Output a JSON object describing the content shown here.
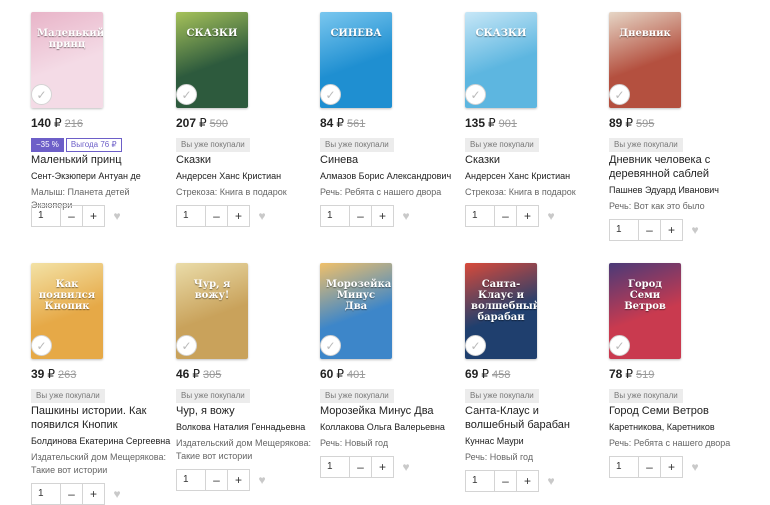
{
  "currency": "₽",
  "qty_default": "1",
  "books": [
    {
      "title": "Маленький принц",
      "author": "Сент-Экзюпери Антуан де",
      "series": "Малыш: Планета детей Экзюпери",
      "price": "140",
      "old_price": "216",
      "discount": "−35 %",
      "saving": "Выгода 76 ₽",
      "bought": "",
      "cover_text": "Маленький принц",
      "cover_bg": "#f4dbe6",
      "cover_accent": "#e8b4c8"
    },
    {
      "title": "Сказки",
      "author": "Андерсен Ханс Кристиан",
      "series": "Стрекоза: Книга в подарок",
      "price": "207",
      "old_price": "590",
      "discount": "",
      "saving": "",
      "bought": "Вы уже покупали",
      "cover_text": "СКАЗКИ",
      "cover_bg": "#2d5a3d",
      "cover_accent": "#a6c25a"
    },
    {
      "title": "Синева",
      "author": "Алмазов Борис Александрович",
      "series": "Речь: Ребята с нашего двора",
      "price": "84",
      "old_price": "561",
      "discount": "",
      "saving": "",
      "bought": "Вы уже покупали",
      "cover_text": "СИНЕВА",
      "cover_bg": "#1f8fd1",
      "cover_accent": "#7ac7ef"
    },
    {
      "title": "Сказки",
      "author": "Андерсен Ханс Кристиан",
      "series": "Стрекоза: Книга в подарок",
      "price": "135",
      "old_price": "901",
      "discount": "",
      "saving": "",
      "bought": "Вы уже покупали",
      "cover_text": "СКАЗКИ",
      "cover_bg": "#5db6e0",
      "cover_accent": "#c7e7f7"
    },
    {
      "title": "Дневник человека с деревянной саблей",
      "author": "Пашнев Эдуард Иванович",
      "series": "Речь: Вот как это было",
      "price": "89",
      "old_price": "595",
      "discount": "",
      "saving": "",
      "bought": "Вы уже покупали",
      "cover_text": "Дневник",
      "cover_bg": "#b4503f",
      "cover_accent": "#e6d6c6"
    },
    {
      "title": "Пашкины истории. Как появился Кнопик",
      "author": "Болдинова Екатерина Сергеевна",
      "series": "Издательский дом Мещерякова: Такие вот истории",
      "price": "39",
      "old_price": "263",
      "discount": "",
      "saving": "",
      "bought": "Вы уже покупали",
      "cover_text": "Как появился Кнопик",
      "cover_bg": "#e6a947",
      "cover_accent": "#f3e2a6"
    },
    {
      "title": "Чур, я вожу",
      "author": "Волкова Наталия Геннадьевна",
      "series": "Издательский дом Мещерякова: Такие вот истории",
      "price": "46",
      "old_price": "305",
      "discount": "",
      "saving": "",
      "bought": "Вы уже покупали",
      "cover_text": "Чур, я вожу!",
      "cover_bg": "#c9a25b",
      "cover_accent": "#eadca9"
    },
    {
      "title": "Морозейка Минус Два",
      "author": "Коллакова Ольга Валерьевна",
      "series": "Речь: Новый год",
      "price": "60",
      "old_price": "401",
      "discount": "",
      "saving": "",
      "bought": "Вы уже покупали",
      "cover_text": "Морозейка Минус Два",
      "cover_bg": "#3d86c9",
      "cover_accent": "#f0c06a"
    },
    {
      "title": "Санта-Клаус и волшебный барабан",
      "author": "Куннас Маури",
      "series": "Речь: Новый год",
      "price": "69",
      "old_price": "458",
      "discount": "",
      "saving": "",
      "bought": "Вы уже покупали",
      "cover_text": "Санта-Клаус и волшебный барабан",
      "cover_bg": "#1f3f6e",
      "cover_accent": "#d84a3a"
    },
    {
      "title": "Город Семи Ветров",
      "author": "Каретникова, Каретников",
      "series": "Речь: Ребята с нашего двора",
      "price": "78",
      "old_price": "519",
      "discount": "",
      "saving": "",
      "bought": "Вы уже покупали",
      "cover_text": "Город Семи Ветров",
      "cover_bg": "#c93a4f",
      "cover_accent": "#4a3a78"
    }
  ]
}
